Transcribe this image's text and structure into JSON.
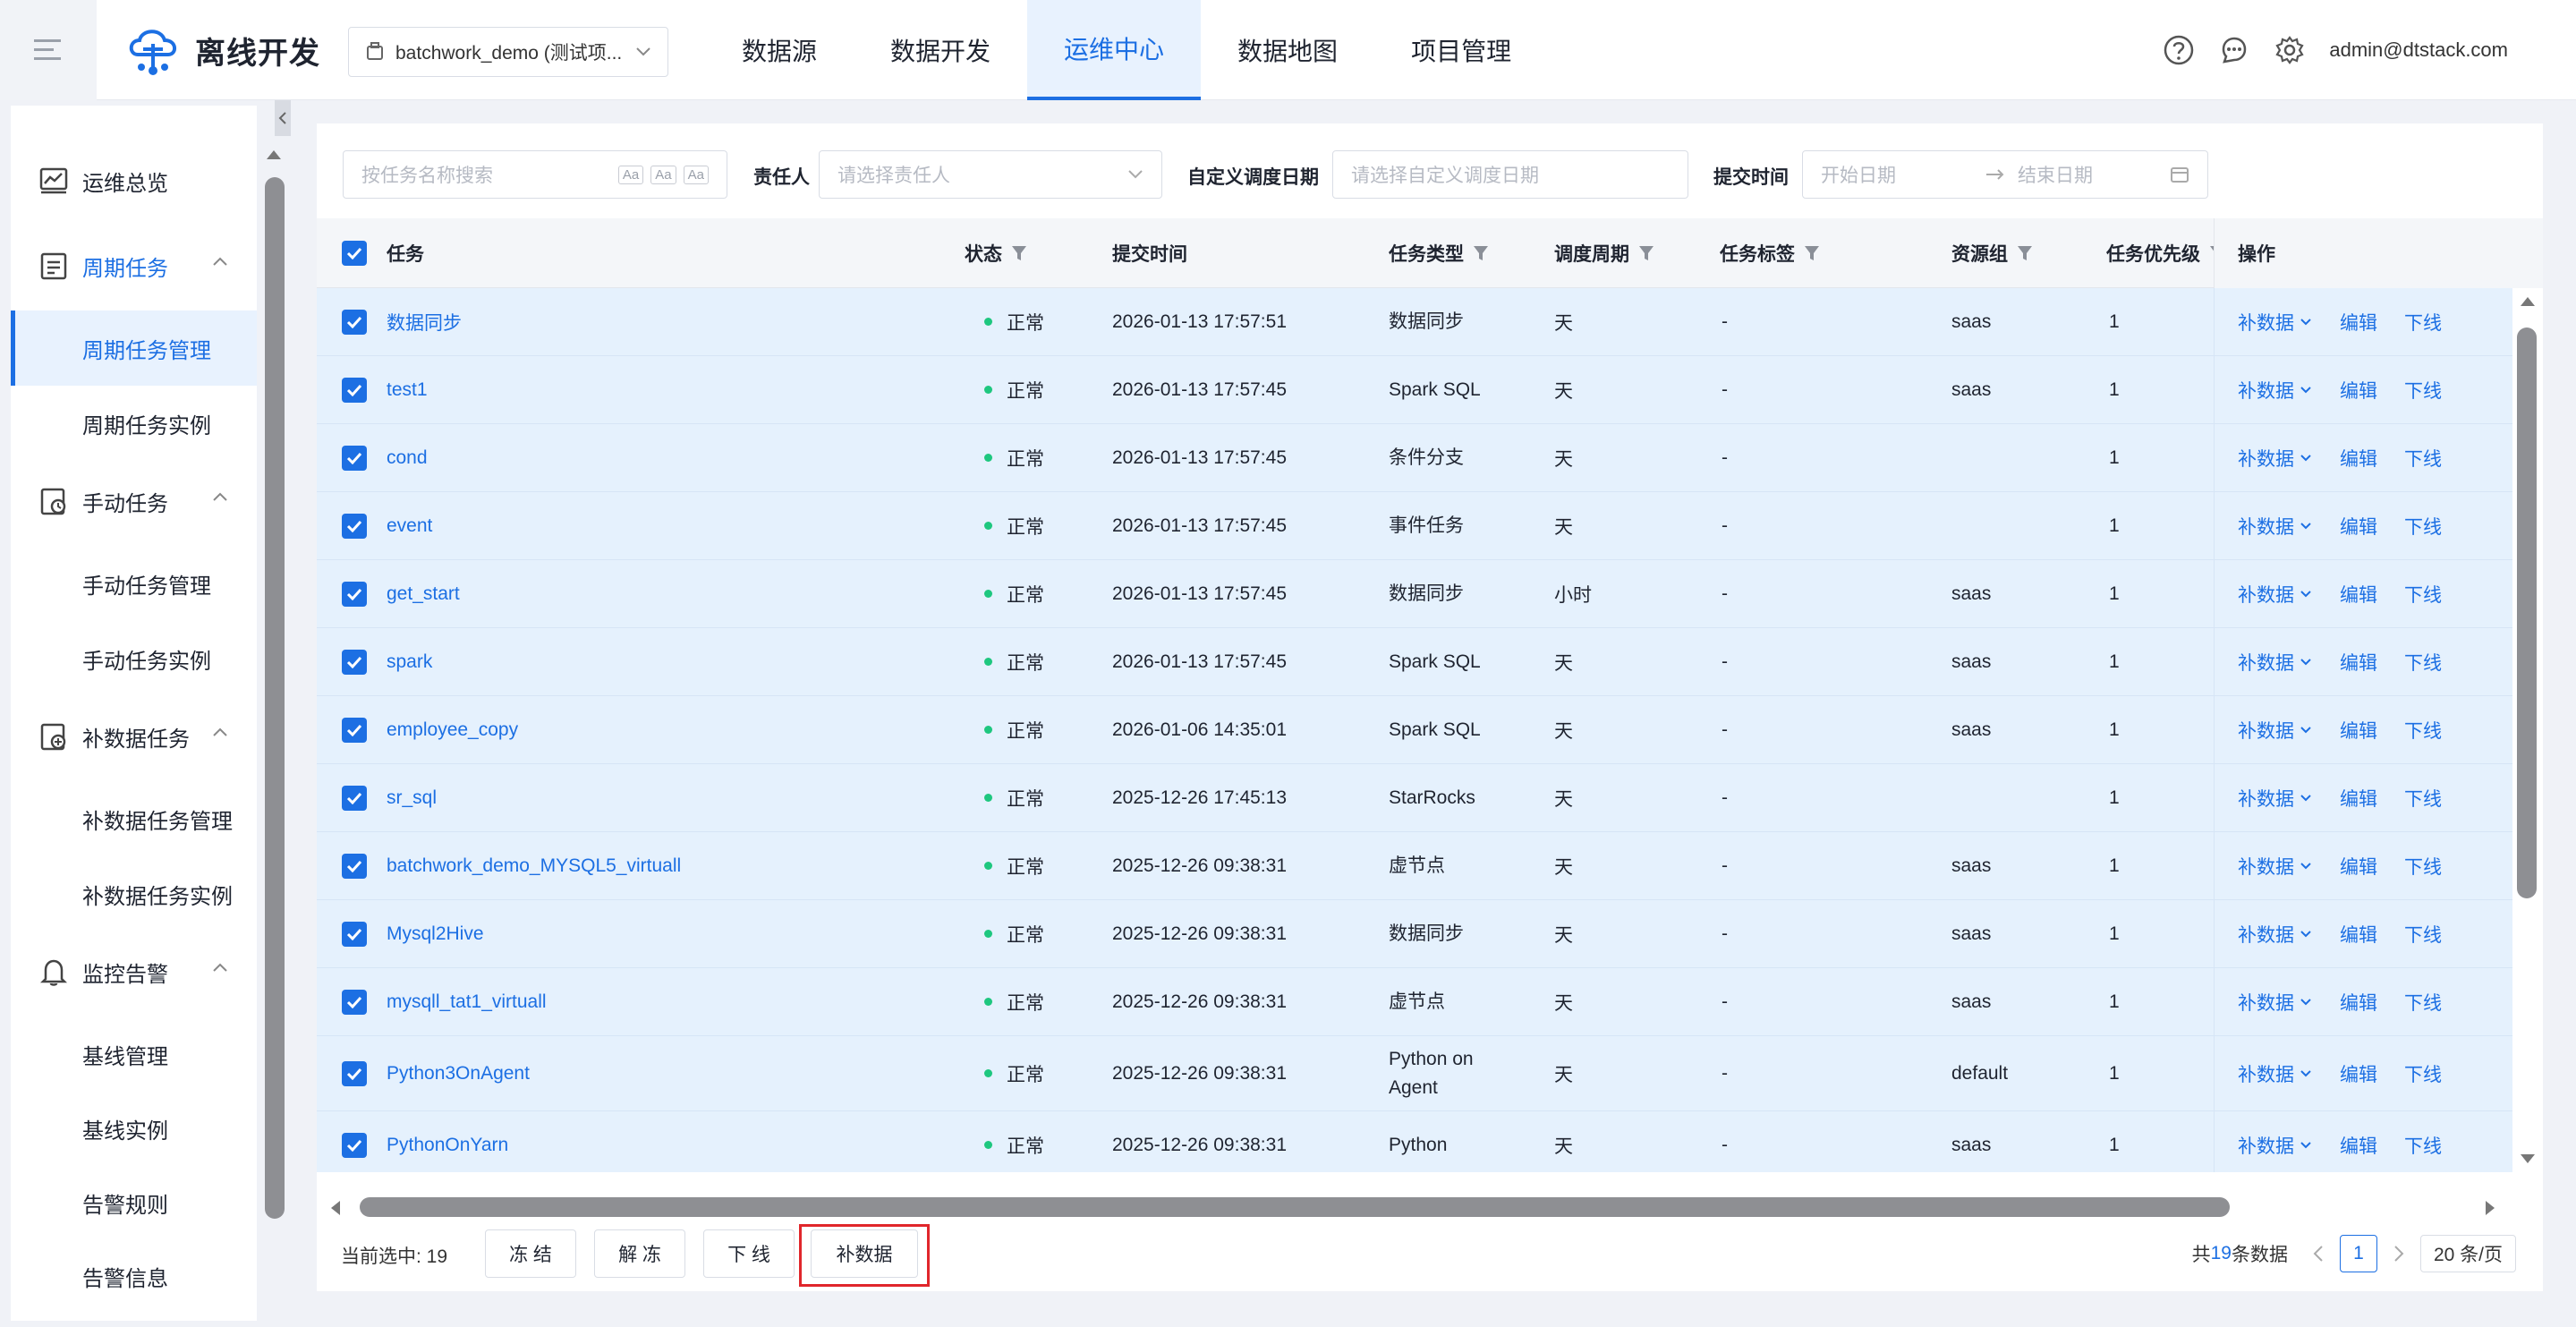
{
  "header": {
    "app_name": "离线开发",
    "project": "batchwork_demo (测试项...",
    "nav": [
      "数据源",
      "数据开发",
      "运维中心",
      "数据地图",
      "项目管理"
    ],
    "active_nav": "运维中心",
    "user": "admin@dtstack.com",
    "brand_color": "#1c6fe3"
  },
  "sidebar": {
    "groups": [
      {
        "label": "运维总览",
        "icon": "dashboard-icon"
      },
      {
        "label": "周期任务",
        "icon": "calendar-list-icon",
        "items": [
          "周期任务管理",
          "周期任务实例"
        ]
      },
      {
        "label": "手动任务",
        "icon": "manual-task-icon",
        "items": [
          "手动任务管理",
          "手动任务实例"
        ]
      },
      {
        "label": "补数据任务",
        "icon": "patch-data-icon",
        "items": [
          "补数据任务管理",
          "补数据任务实例"
        ]
      },
      {
        "label": "监控告警",
        "icon": "bell-icon",
        "items": [
          "基线管理",
          "基线实例",
          "告警规则",
          "告警信息"
        ]
      }
    ],
    "active_item": "周期任务管理"
  },
  "filters": {
    "search_placeholder": "按任务名称搜索",
    "owner_label": "责任人",
    "owner_placeholder": "请选择责任人",
    "date_label": "自定义调度日期",
    "date_placeholder": "请选择自定义调度日期",
    "submit_label": "提交时间",
    "start_placeholder": "开始日期",
    "end_placeholder": "结束日期"
  },
  "table": {
    "columns": [
      "任务",
      "状态",
      "提交时间",
      "任务类型",
      "调度周期",
      "任务标签",
      "资源组",
      "任务优先级",
      "操作"
    ],
    "ops": [
      "补数据",
      "编辑",
      "下线"
    ],
    "rows": [
      {
        "task": "数据同步",
        "status": "正常",
        "time": "2026-01-13 17:57:51",
        "type": "数据同步",
        "cycle": "天",
        "tag": "-",
        "group": "saas",
        "priority": "1"
      },
      {
        "task": "test1",
        "status": "正常",
        "time": "2026-01-13 17:57:45",
        "type": "Spark SQL",
        "cycle": "天",
        "tag": "-",
        "group": "saas",
        "priority": "1"
      },
      {
        "task": "cond",
        "status": "正常",
        "time": "2026-01-13 17:57:45",
        "type": "条件分支",
        "cycle": "天",
        "tag": "-",
        "group": "",
        "priority": "1"
      },
      {
        "task": "event",
        "status": "正常",
        "time": "2026-01-13 17:57:45",
        "type": "事件任务",
        "cycle": "天",
        "tag": "-",
        "group": "",
        "priority": "1"
      },
      {
        "task": "get_start",
        "status": "正常",
        "time": "2026-01-13 17:57:45",
        "type": "数据同步",
        "cycle": "小时",
        "tag": "-",
        "group": "saas",
        "priority": "1"
      },
      {
        "task": "spark",
        "status": "正常",
        "time": "2026-01-13 17:57:45",
        "type": "Spark SQL",
        "cycle": "天",
        "tag": "-",
        "group": "saas",
        "priority": "1"
      },
      {
        "task": "employee_copy",
        "status": "正常",
        "time": "2026-01-06 14:35:01",
        "type": "Spark SQL",
        "cycle": "天",
        "tag": "-",
        "group": "saas",
        "priority": "1"
      },
      {
        "task": "sr_sql",
        "status": "正常",
        "time": "2025-12-26 17:45:13",
        "type": "StarRocks",
        "cycle": "天",
        "tag": "-",
        "group": "",
        "priority": "1"
      },
      {
        "task": "batchwork_demo_MYSQL5_virtuall",
        "status": "正常",
        "time": "2025-12-26 09:38:31",
        "type": "虚节点",
        "cycle": "天",
        "tag": "-",
        "group": "saas",
        "priority": "1"
      },
      {
        "task": "Mysql2Hive",
        "status": "正常",
        "time": "2025-12-26 09:38:31",
        "type": "数据同步",
        "cycle": "天",
        "tag": "-",
        "group": "saas",
        "priority": "1"
      },
      {
        "task": "mysqll_tat1_virtuall",
        "status": "正常",
        "time": "2025-12-26 09:38:31",
        "type": "虚节点",
        "cycle": "天",
        "tag": "-",
        "group": "saas",
        "priority": "1"
      },
      {
        "task": "Python3OnAgent",
        "status": "正常",
        "time": "2025-12-26 09:38:31",
        "type": "Python on Agent",
        "cycle": "天",
        "tag": "-",
        "group": "default",
        "priority": "1"
      },
      {
        "task": "PythonOnYarn",
        "status": "正常",
        "time": "2025-12-26 09:38:31",
        "type": "Python",
        "cycle": "天",
        "tag": "-",
        "group": "saas",
        "priority": "1"
      }
    ]
  },
  "footer": {
    "selected_label": "当前选中: 19",
    "buttons": [
      "冻 结",
      "解 冻",
      "下 线",
      "补数据"
    ],
    "total_prefix": "共",
    "total_count": "19",
    "total_suffix": "条数据",
    "page": "1",
    "page_size": "20 条/页"
  }
}
